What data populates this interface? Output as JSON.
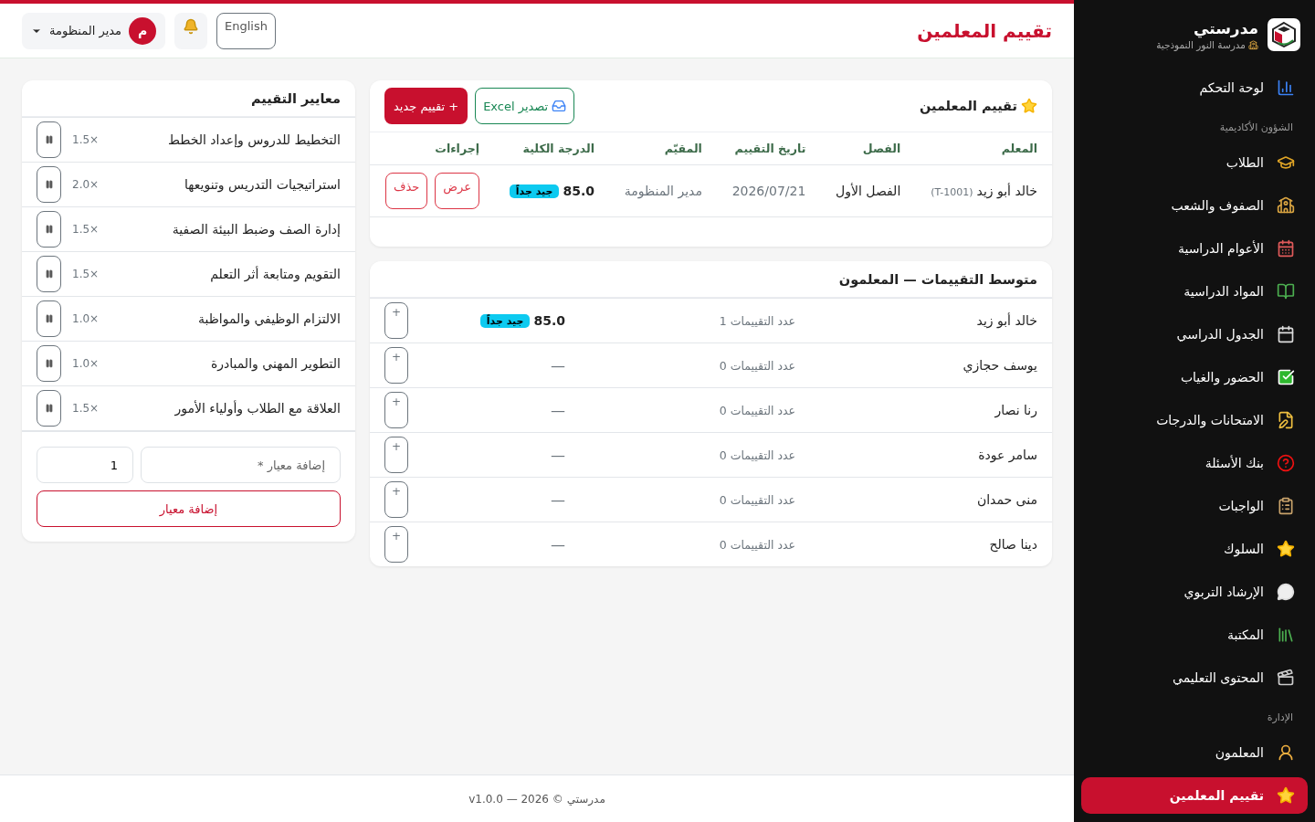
{
  "sidebar": {
    "brand": {
      "title": "مدرستي",
      "subtitle": "مدرسة النور النموذجية"
    },
    "groups": [
      {
        "items": [
          {
            "label": "لوحة التحكم",
            "selected": false
          }
        ]
      },
      {
        "heading": "الشؤون الأكاديمية",
        "items": [
          {
            "label": "الطلاب",
            "selected": false
          },
          {
            "label": "الصفوف والشعب",
            "selected": false
          },
          {
            "label": "الأعوام الدراسية",
            "selected": false
          },
          {
            "label": "المواد الدراسية",
            "selected": false
          },
          {
            "label": "الجدول الدراسي",
            "selected": false
          },
          {
            "label": "الحضور والغياب",
            "selected": false
          },
          {
            "label": "الامتحانات والدرجات",
            "selected": false
          },
          {
            "label": "بنك الأسئلة",
            "selected": false
          },
          {
            "label": "الواجبات",
            "selected": false
          },
          {
            "label": "السلوك",
            "selected": false
          },
          {
            "label": "الإرشاد التربوي",
            "selected": false
          },
          {
            "label": "المكتبة",
            "selected": false
          },
          {
            "label": "المحتوى التعليمي",
            "selected": false
          }
        ]
      },
      {
        "heading": "الإدارة",
        "items": [
          {
            "label": "المعلمون",
            "selected": false
          },
          {
            "label": "تقييم المعلمين",
            "selected": true
          }
        ]
      }
    ]
  },
  "header": {
    "title": "تقييم المعلمين",
    "language_button": "English",
    "user": {
      "initial": "م",
      "name": "مدير المنظومة"
    }
  },
  "evaluations": {
    "title": "تقييم المعلمين",
    "export_button": "تصدير Excel",
    "new_button": "+ تقييم جديد",
    "columns": [
      "المعلم",
      "الفصل",
      "تاريخ التقييم",
      "المقيّم",
      "الدرجة الكلية",
      "إجراءات"
    ],
    "rows": [
      {
        "teacher": "خالد أبو زيد",
        "code": "(T-1001)",
        "term": "الفصل الأول",
        "date": "2026/07/21",
        "evaluator": "مدير المنظومة",
        "score": "85.0",
        "grade": "جيد جداً",
        "actions": [
          "عرض",
          "حذف"
        ]
      }
    ]
  },
  "averages": {
    "title": "متوسط التقييمات — المعلمون",
    "rows": [
      {
        "teacher": "خالد أبو زيد",
        "count": "عدد التقييمات 1",
        "score": "85.0",
        "grade": "جيد جداً",
        "button": "+"
      },
      {
        "teacher": "يوسف حجازي",
        "count": "عدد التقييمات 0",
        "score": "—",
        "button": "+"
      },
      {
        "teacher": "رنا نصار",
        "count": "عدد التقييمات 0",
        "score": "—",
        "button": "+"
      },
      {
        "teacher": "سامر عودة",
        "count": "عدد التقييمات 0",
        "score": "—",
        "button": "+"
      },
      {
        "teacher": "منى حمدان",
        "count": "عدد التقييمات 0",
        "score": "—",
        "button": "+"
      },
      {
        "teacher": "دينا صالح",
        "count": "عدد التقييمات 0",
        "score": "—",
        "button": "+"
      }
    ]
  },
  "criteria": {
    "title": "معايير التقييم",
    "items": [
      {
        "name": "التخطيط للدروس وإعداد الخطط",
        "weight": "1.5×"
      },
      {
        "name": "استراتيجيات التدريس وتنويعها",
        "weight": "2.0×"
      },
      {
        "name": "إدارة الصف وضبط البيئة الصفية",
        "weight": "1.5×"
      },
      {
        "name": "التقويم ومتابعة أثر التعلم",
        "weight": "1.5×"
      },
      {
        "name": "الالتزام الوظيفي والمواظبة",
        "weight": "1.0×"
      },
      {
        "name": "التطوير المهني والمبادرة",
        "weight": "1.0×"
      },
      {
        "name": "العلاقة مع الطلاب وأولياء الأمور",
        "weight": "1.5×"
      }
    ],
    "name_field": {
      "placeholder": "إضافة معيار *"
    },
    "weight_field": {
      "value": "1"
    },
    "add_button": "إضافة معيار"
  },
  "footer": "مدرستي © 2026 — v1.0.0"
}
